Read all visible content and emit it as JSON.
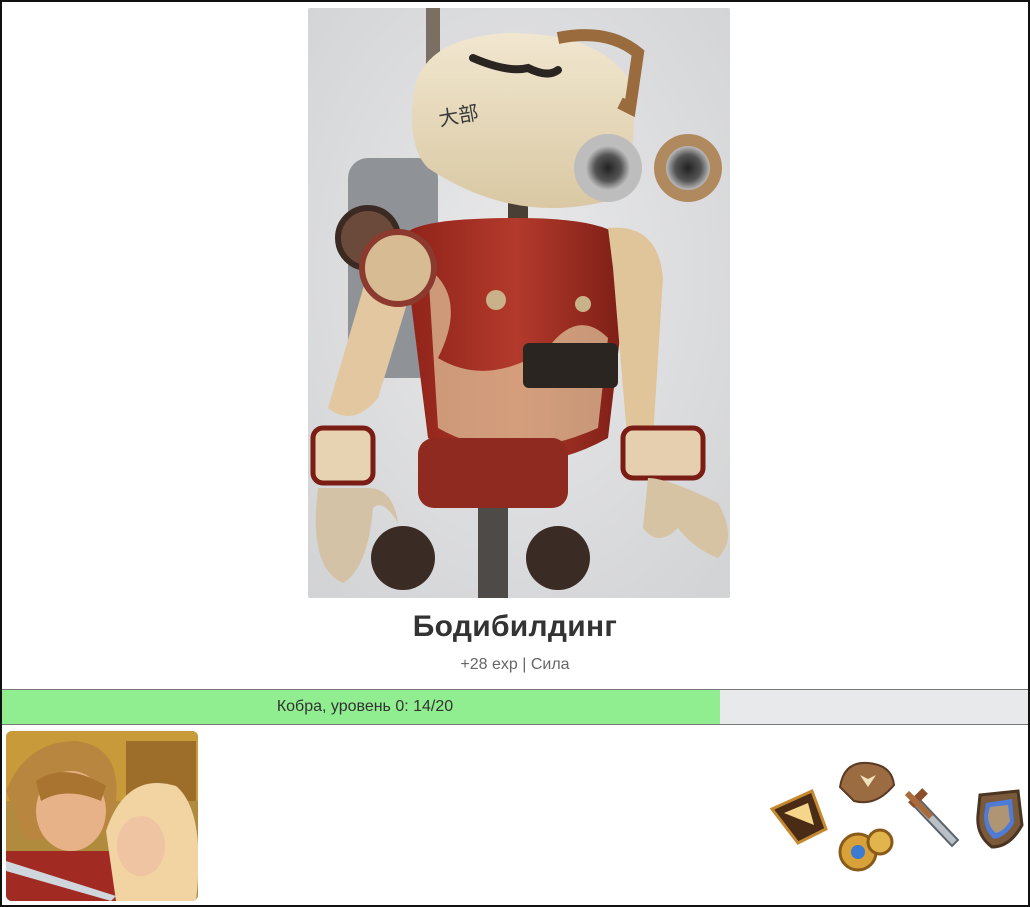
{
  "activity": {
    "title": "Бодибилдинг",
    "reward": "+28 exp | Сила"
  },
  "progress": {
    "label": "Кобра, уровень 0: 14/20",
    "fraction": 0.7
  },
  "images": {
    "hero": "steampunk-robot-image",
    "avatar": "anime-character-avatar"
  },
  "items": [
    {
      "name": "chevron-badge-icon"
    },
    {
      "name": "hat-icon"
    },
    {
      "name": "gear-icon"
    },
    {
      "name": "sword-icon"
    },
    {
      "name": "shield-icon"
    }
  ],
  "colors": {
    "progress_fill": "#90ee90",
    "progress_track": "#e7e9ea"
  }
}
